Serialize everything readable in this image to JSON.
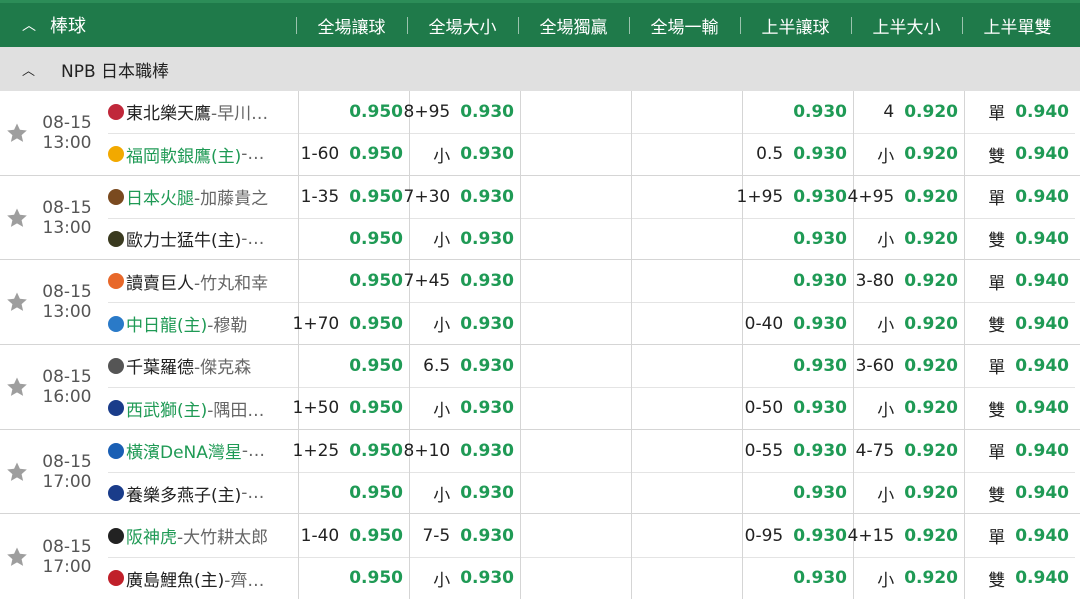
{
  "header": {
    "sport": "棒球",
    "columns": [
      "全場讓球",
      "全場大小",
      "全場獨贏",
      "全場一輸",
      "上半讓球",
      "上半大小",
      "上半單雙"
    ]
  },
  "league": {
    "name": "NPB 日本職棒"
  },
  "colors": {
    "header_bg": "#1f7a4a",
    "league_bg": "#e0e0e0",
    "odd_green": "#1f9a55"
  },
  "matches": [
    {
      "date": "08-15",
      "time": "13:00",
      "teams": [
        {
          "name": "東北樂天鷹",
          "pitcher": "-早川…",
          "green": false,
          "logo": "#c0283a"
        },
        {
          "name": "福岡軟銀鷹(主)",
          "pitcher": "-…",
          "green": true,
          "logo": "#f2a900"
        }
      ],
      "cols": [
        [
          [
            "",
            "0.950"
          ],
          [
            "1-60",
            "0.950"
          ]
        ],
        [
          [
            "8+95",
            "0.930"
          ],
          [
            "小",
            "0.930"
          ]
        ],
        [
          [
            "",
            ""
          ],
          [
            "",
            ""
          ]
        ],
        [
          [
            "",
            ""
          ],
          [
            "",
            ""
          ]
        ],
        [
          [
            "",
            "0.930"
          ],
          [
            "0.5",
            "0.930"
          ]
        ],
        [
          [
            "4",
            "0.920"
          ],
          [
            "小",
            "0.920"
          ]
        ],
        [
          [
            "單",
            "0.940"
          ],
          [
            "雙",
            "0.940"
          ]
        ]
      ]
    },
    {
      "date": "08-15",
      "time": "13:00",
      "teams": [
        {
          "name": "日本火腿",
          "pitcher": "-加藤貴之",
          "green": true,
          "logo": "#7a4a1f"
        },
        {
          "name": "歐力士猛牛(主)",
          "pitcher": "-…",
          "green": false,
          "logo": "#3a3a1f"
        }
      ],
      "cols": [
        [
          [
            "1-35",
            "0.950"
          ],
          [
            "",
            "0.950"
          ]
        ],
        [
          [
            "7+30",
            "0.930"
          ],
          [
            "小",
            "0.930"
          ]
        ],
        [
          [
            "",
            ""
          ],
          [
            "",
            ""
          ]
        ],
        [
          [
            "",
            ""
          ],
          [
            "",
            ""
          ]
        ],
        [
          [
            "1+95",
            "0.930"
          ],
          [
            "",
            "0.930"
          ]
        ],
        [
          [
            "4+95",
            "0.920"
          ],
          [
            "小",
            "0.920"
          ]
        ],
        [
          [
            "單",
            "0.940"
          ],
          [
            "雙",
            "0.940"
          ]
        ]
      ]
    },
    {
      "date": "08-15",
      "time": "13:00",
      "teams": [
        {
          "name": "讀賣巨人",
          "pitcher": "-竹丸和幸",
          "green": false,
          "logo": "#e8682a"
        },
        {
          "name": "中日龍(主)",
          "pitcher": "-穆勒",
          "green": true,
          "logo": "#2a7ac8"
        }
      ],
      "cols": [
        [
          [
            "",
            "0.950"
          ],
          [
            "1+70",
            "0.950"
          ]
        ],
        [
          [
            "7+45",
            "0.930"
          ],
          [
            "小",
            "0.930"
          ]
        ],
        [
          [
            "",
            ""
          ],
          [
            "",
            ""
          ]
        ],
        [
          [
            "",
            ""
          ],
          [
            "",
            ""
          ]
        ],
        [
          [
            "",
            "0.930"
          ],
          [
            "0-40",
            "0.930"
          ]
        ],
        [
          [
            "3-80",
            "0.920"
          ],
          [
            "小",
            "0.920"
          ]
        ],
        [
          [
            "單",
            "0.940"
          ],
          [
            "雙",
            "0.940"
          ]
        ]
      ]
    },
    {
      "date": "08-15",
      "time": "16:00",
      "teams": [
        {
          "name": "千葉羅德",
          "pitcher": "-傑克森",
          "green": false,
          "logo": "#555555"
        },
        {
          "name": "西武獅(主)",
          "pitcher": "-隅田…",
          "green": true,
          "logo": "#1a3c8a"
        }
      ],
      "cols": [
        [
          [
            "",
            "0.950"
          ],
          [
            "1+50",
            "0.950"
          ]
        ],
        [
          [
            "6.5",
            "0.930"
          ],
          [
            "小",
            "0.930"
          ]
        ],
        [
          [
            "",
            ""
          ],
          [
            "",
            ""
          ]
        ],
        [
          [
            "",
            ""
          ],
          [
            "",
            ""
          ]
        ],
        [
          [
            "",
            "0.930"
          ],
          [
            "0-50",
            "0.930"
          ]
        ],
        [
          [
            "3-60",
            "0.920"
          ],
          [
            "小",
            "0.920"
          ]
        ],
        [
          [
            "單",
            "0.940"
          ],
          [
            "雙",
            "0.940"
          ]
        ]
      ]
    },
    {
      "date": "08-15",
      "time": "17:00",
      "teams": [
        {
          "name": "橫濱DeNA灣星",
          "pitcher": "-…",
          "green": true,
          "logo": "#1a5fb4"
        },
        {
          "name": "養樂多燕子(主)",
          "pitcher": "-…",
          "green": false,
          "logo": "#1a3c8a"
        }
      ],
      "cols": [
        [
          [
            "1+25",
            "0.950"
          ],
          [
            "",
            "0.950"
          ]
        ],
        [
          [
            "8+10",
            "0.930"
          ],
          [
            "小",
            "0.930"
          ]
        ],
        [
          [
            "",
            ""
          ],
          [
            "",
            ""
          ]
        ],
        [
          [
            "",
            ""
          ],
          [
            "",
            ""
          ]
        ],
        [
          [
            "0-55",
            "0.930"
          ],
          [
            "",
            "0.930"
          ]
        ],
        [
          [
            "4-75",
            "0.920"
          ],
          [
            "小",
            "0.920"
          ]
        ],
        [
          [
            "單",
            "0.940"
          ],
          [
            "雙",
            "0.940"
          ]
        ]
      ]
    },
    {
      "date": "08-15",
      "time": "17:00",
      "teams": [
        {
          "name": "阪神虎",
          "pitcher": "-大竹耕太郎",
          "green": true,
          "logo": "#222222"
        },
        {
          "name": "廣島鯉魚(主)",
          "pitcher": "-齊…",
          "green": false,
          "logo": "#c0202a"
        }
      ],
      "cols": [
        [
          [
            "1-40",
            "0.950"
          ],
          [
            "",
            "0.950"
          ]
        ],
        [
          [
            "7-5",
            "0.930"
          ],
          [
            "小",
            "0.930"
          ]
        ],
        [
          [
            "",
            ""
          ],
          [
            "",
            ""
          ]
        ],
        [
          [
            "",
            ""
          ],
          [
            "",
            ""
          ]
        ],
        [
          [
            "0-95",
            "0.930"
          ],
          [
            "",
            "0.930"
          ]
        ],
        [
          [
            "4+15",
            "0.920"
          ],
          [
            "小",
            "0.920"
          ]
        ],
        [
          [
            "單",
            "0.940"
          ],
          [
            "雙",
            "0.940"
          ]
        ]
      ]
    }
  ]
}
